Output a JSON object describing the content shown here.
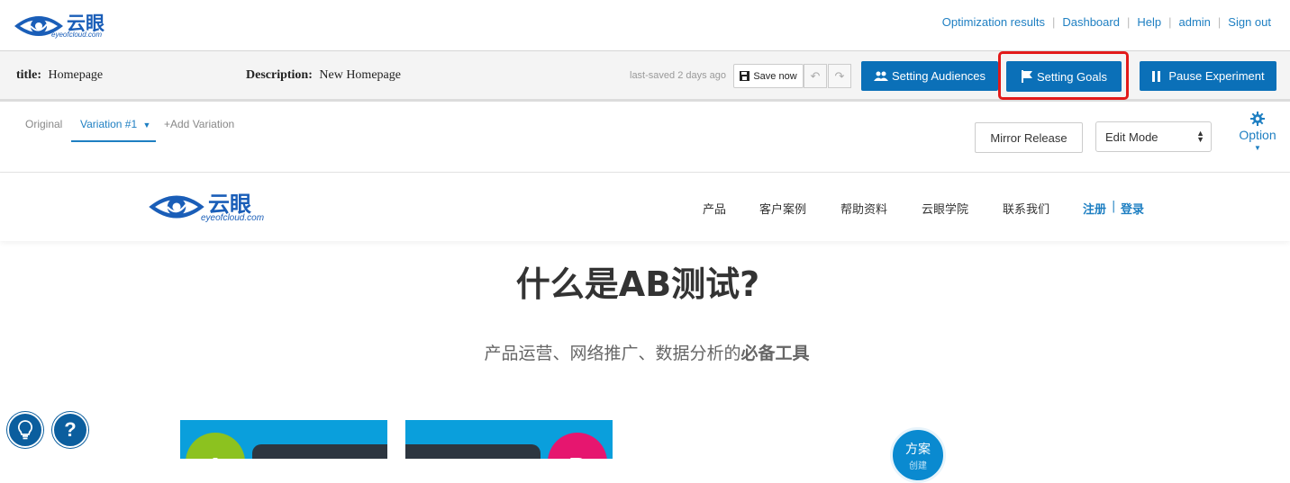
{
  "brand": {
    "logo_text": "云眼",
    "logo_sub": "eyeofcloud.com",
    "color": "#1a5eb8"
  },
  "top_links": [
    "Optimization results",
    "Dashboard",
    "Help",
    "admin",
    "Sign out"
  ],
  "toolbar": {
    "title_label": "title:",
    "title_value": "Homepage",
    "description_label": "Description:",
    "description_value": "New Homepage",
    "last_saved": "last-saved 2 days ago",
    "save_label": "Save now",
    "audiences_label": "Setting Audiences",
    "goals_label": "Setting Goals",
    "pause_label": "Pause Experiment",
    "accent": "#0b70b8",
    "highlight_color": "#e21a1a"
  },
  "tabs": {
    "original": "Original",
    "variation": "Variation #1",
    "add": "+Add Variation"
  },
  "controls": {
    "mirror_label": "Mirror Release",
    "edit_mode_value": "Edit Mode",
    "option_label": "Option"
  },
  "site": {
    "nav": [
      "产品",
      "客户案例",
      "帮助资料",
      "云眼学院",
      "联系我们"
    ],
    "register": "注册",
    "login": "登录",
    "hero_title": "什么是AB测试?",
    "hero_subtitle_normal": "产品运营、网络推广、数据分析的",
    "hero_subtitle_bold": "必备工具",
    "card_a": "A",
    "card_b": "B",
    "plan_text": "方案",
    "plan_sub": "创建"
  },
  "fabs": {
    "help": "?"
  }
}
